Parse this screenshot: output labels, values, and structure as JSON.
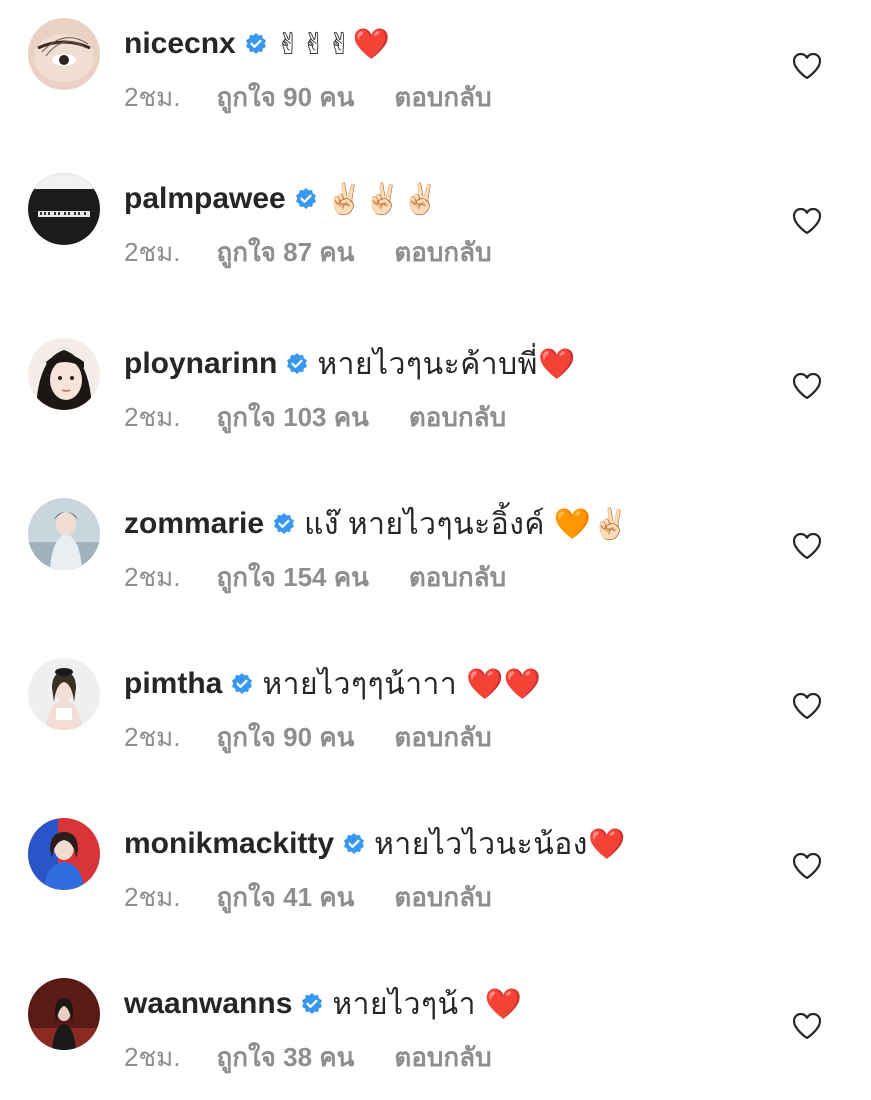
{
  "comments": [
    {
      "username": "nicecnx",
      "text": "✌✌✌❤️",
      "time": "2ชม.",
      "likes": "ถูกใจ 90 คน",
      "reply": "ตอบกลับ",
      "verified": true
    },
    {
      "username": "palmpawee",
      "text": "✌🏻✌🏻✌🏻",
      "time": "2ชม.",
      "likes": "ถูกใจ 87 คน",
      "reply": "ตอบกลับ",
      "verified": true
    },
    {
      "username": "ploynarinn",
      "text": "หายไวๆนะค้าบพี่❤️",
      "time": "2ชม.",
      "likes": "ถูกใจ 103 คน",
      "reply": "ตอบกลับ",
      "verified": true
    },
    {
      "username": "zommarie",
      "text": "แง๊ หายไวๆนะอิ้งค์ 🧡✌🏻",
      "time": "2ชม.",
      "likes": "ถูกใจ 154 คน",
      "reply": "ตอบกลับ",
      "verified": true
    },
    {
      "username": "pimtha",
      "text": "หายไวๆๆน้าาา ❤️❤️",
      "time": "2ชม.",
      "likes": "ถูกใจ 90 คน",
      "reply": "ตอบกลับ",
      "verified": true
    },
    {
      "username": "monikmackitty",
      "text": "หายไวไวนะน้อง❤️",
      "time": "2ชม.",
      "likes": "ถูกใจ 41 คน",
      "reply": "ตอบกลับ",
      "verified": true
    },
    {
      "username": "waanwanns",
      "text": "หายไวๆน้า ❤️",
      "time": "2ชม.",
      "likes": "ถูกใจ 38 คน",
      "reply": "ตอบกลับ",
      "verified": true
    }
  ],
  "icons": {
    "verified": "verified-badge-icon",
    "like": "heart-outline-icon"
  },
  "colors": {
    "verified": "#3897f0",
    "meta_text": "#8e8e8e",
    "username": "#262626"
  }
}
